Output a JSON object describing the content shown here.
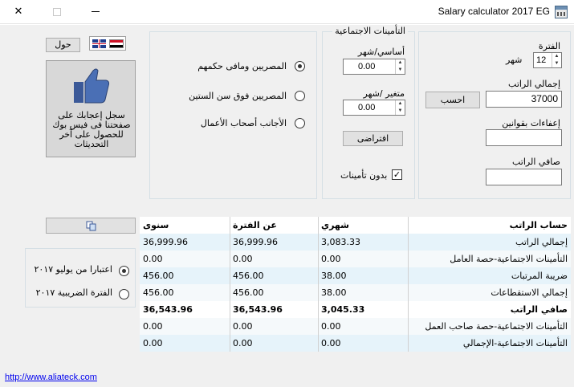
{
  "window": {
    "title": "Salary calculator 2017 EG"
  },
  "period": {
    "label": "الفترة",
    "unit": "شهر",
    "value": "12"
  },
  "gross": {
    "label": "إجمالي الراتب",
    "value": "37000"
  },
  "legal_exemptions": {
    "label": "إعفاءات بقوانين",
    "value": ""
  },
  "net": {
    "label": "صافي الراتب",
    "value": ""
  },
  "calculate_label": "احسب",
  "insurance": {
    "title": "التأمينات الاجتماعية",
    "basic_label": "أساسي/شهر",
    "basic_value": "0.00",
    "variable_label": "متغير /شهر",
    "variable_value": "0.00",
    "default_label": "افتراضى",
    "no_insurance_label": "بدون تأمينات",
    "no_insurance_checked": "✓"
  },
  "nationality": {
    "options": [
      "المصريين ومافى حكمهم",
      "المصريين فوق سن الستين",
      "الأجانب أصحاب الأعمال"
    ],
    "selected": 0
  },
  "about_label": "حول",
  "facebook_text": "سجل إعجابك على صفحتنا فى فيس بوك للحصول على آخر التحديثات",
  "tax_period": {
    "options": [
      "اعتبارا من يوليو ٢٠١٧",
      "الفترة الضريبية ٢٠١٧"
    ],
    "selected": 0
  },
  "table": {
    "headers": {
      "label": "حساب الراتب",
      "monthly": "شهري",
      "period": "عن الفترة",
      "annual": "سنوى"
    },
    "rows": [
      {
        "label": "إجمالي الراتب",
        "monthly": "3,083.33",
        "period": "36,999.96",
        "annual": "36,999.96"
      },
      {
        "label": "التأمينات الاجتماعية-حصة العامل",
        "monthly": "0.00",
        "period": "0.00",
        "annual": "0.00"
      },
      {
        "label": "ضريبة المرتبات",
        "monthly": "38.00",
        "period": "456.00",
        "annual": "456.00"
      },
      {
        "label": "إجمالي الاستقطاعات",
        "monthly": "38.00",
        "period": "456.00",
        "annual": "456.00"
      },
      {
        "label": "صافي الراتب",
        "monthly": "3,045.33",
        "period": "36,543.96",
        "annual": "36,543.96"
      },
      {
        "label": "التأمينات الاجتماعية-حصة صاحب العمل",
        "monthly": "0.00",
        "period": "0.00",
        "annual": "0.00"
      },
      {
        "label": "التأمينات الاجتماعية-الإجمالي",
        "monthly": "0.00",
        "period": "0.00",
        "annual": "0.00"
      }
    ]
  },
  "website_link": "http://www.aliateck.com",
  "icons": {
    "close": "close-icon",
    "maximize": "maximize-icon",
    "minimize": "minimize-icon",
    "app": "calculator-app-icon",
    "thumbs_up": "thumbs-up-icon",
    "copy": "copy-icon",
    "flags": "language-flags-icon"
  }
}
